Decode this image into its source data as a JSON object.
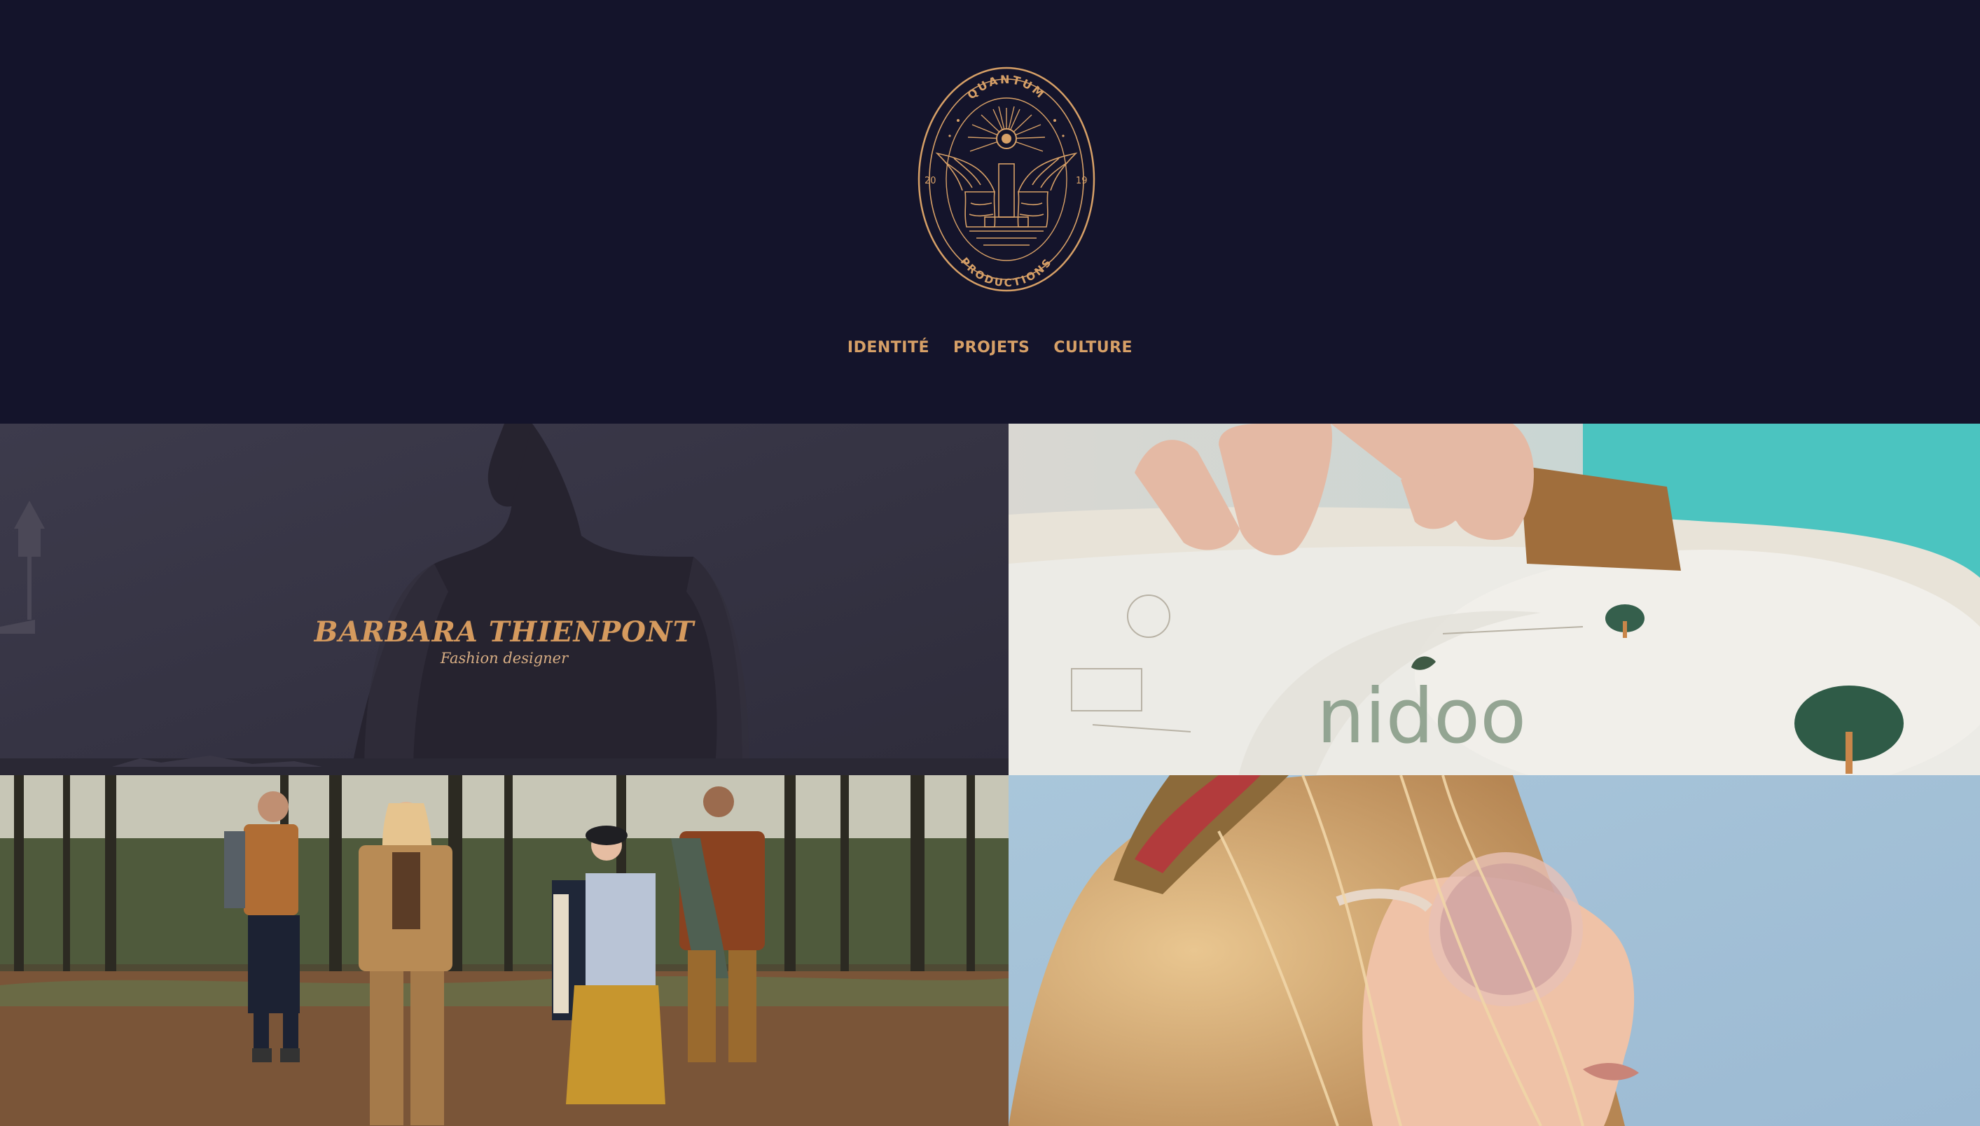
{
  "logo": {
    "top_text": "QUANTUM",
    "bottom_text": "PRODUCTIONS",
    "year_left": "20",
    "year_right": "19",
    "icon": "winged-lions-emblem-icon"
  },
  "nav": {
    "items": [
      {
        "label": "IDENTITÉ"
      },
      {
        "label": "PROJETS"
      },
      {
        "label": "CULTURE"
      }
    ]
  },
  "projects": [
    {
      "title": "BARBARA THIENPONT",
      "subtitle": "Fashion designer"
    },
    {
      "brand": "nidoo"
    }
  ],
  "colors": {
    "background": "#14142b",
    "accent": "#d7a067"
  }
}
